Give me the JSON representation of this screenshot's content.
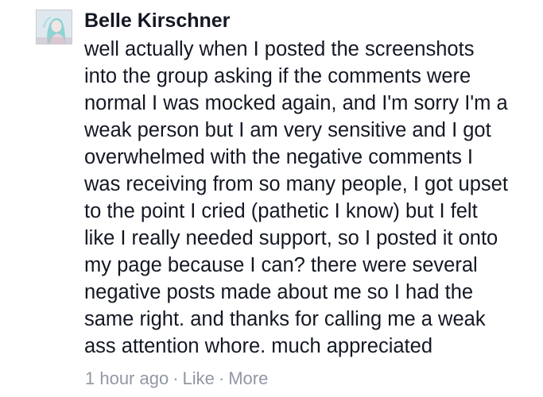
{
  "comment": {
    "author": "Belle Kirschner",
    "text_lines": [
      "well actually when I posted the screenshots",
      "into the group asking if the comments were",
      "normal I was mocked again, and I'm sorry I'm a",
      "weak person but I am very sensitive and I got",
      "overwhelmed with the negative comments I",
      "was receiving from so many people, I got upset",
      "to the point I cried (pathetic I know) but I felt",
      "like I really needed support, so I posted it onto",
      "my page because I can? there were several",
      "negative posts made about me so I had the",
      "same right. and thanks for calling me a weak",
      "ass attention whore. much appreciated"
    ],
    "timestamp": "1 hour ago",
    "separator": "·",
    "like_label": "Like",
    "more_label": "More"
  },
  "colors": {
    "author": "#141823",
    "text": "#141823",
    "meta": "#9197a3",
    "background": "#ffffff"
  }
}
